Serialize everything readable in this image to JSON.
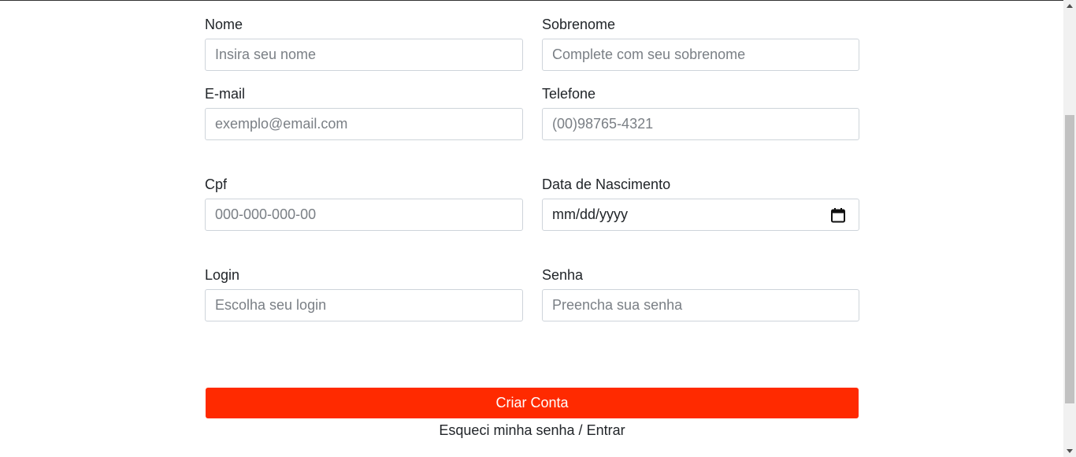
{
  "form": {
    "nome": {
      "label": "Nome",
      "placeholder": "Insira seu nome"
    },
    "sobrenome": {
      "label": "Sobrenome",
      "placeholder": "Complete com seu sobrenome"
    },
    "email": {
      "label": "E-mail",
      "placeholder": "exemplo@email.com"
    },
    "telefone": {
      "label": "Telefone",
      "placeholder": "(00)98765-4321"
    },
    "cpf": {
      "label": "Cpf",
      "placeholder": "000-000-000-00"
    },
    "nascimento": {
      "label": "Data de Nascimento",
      "value": "mm/dd/yyyy",
      "icon": "calendar-icon"
    },
    "login": {
      "label": "Login",
      "placeholder": "Escolha seu login"
    },
    "senha": {
      "label": "Senha",
      "placeholder": "Preencha sua senha"
    },
    "submit_label": "Criar Conta",
    "forgot_label": "Esqueci minha senha",
    "separator": "/",
    "login_label": "Entrar"
  },
  "colors": {
    "accent": "#ff2a00",
    "text": "#212529",
    "border": "#ced4da"
  }
}
